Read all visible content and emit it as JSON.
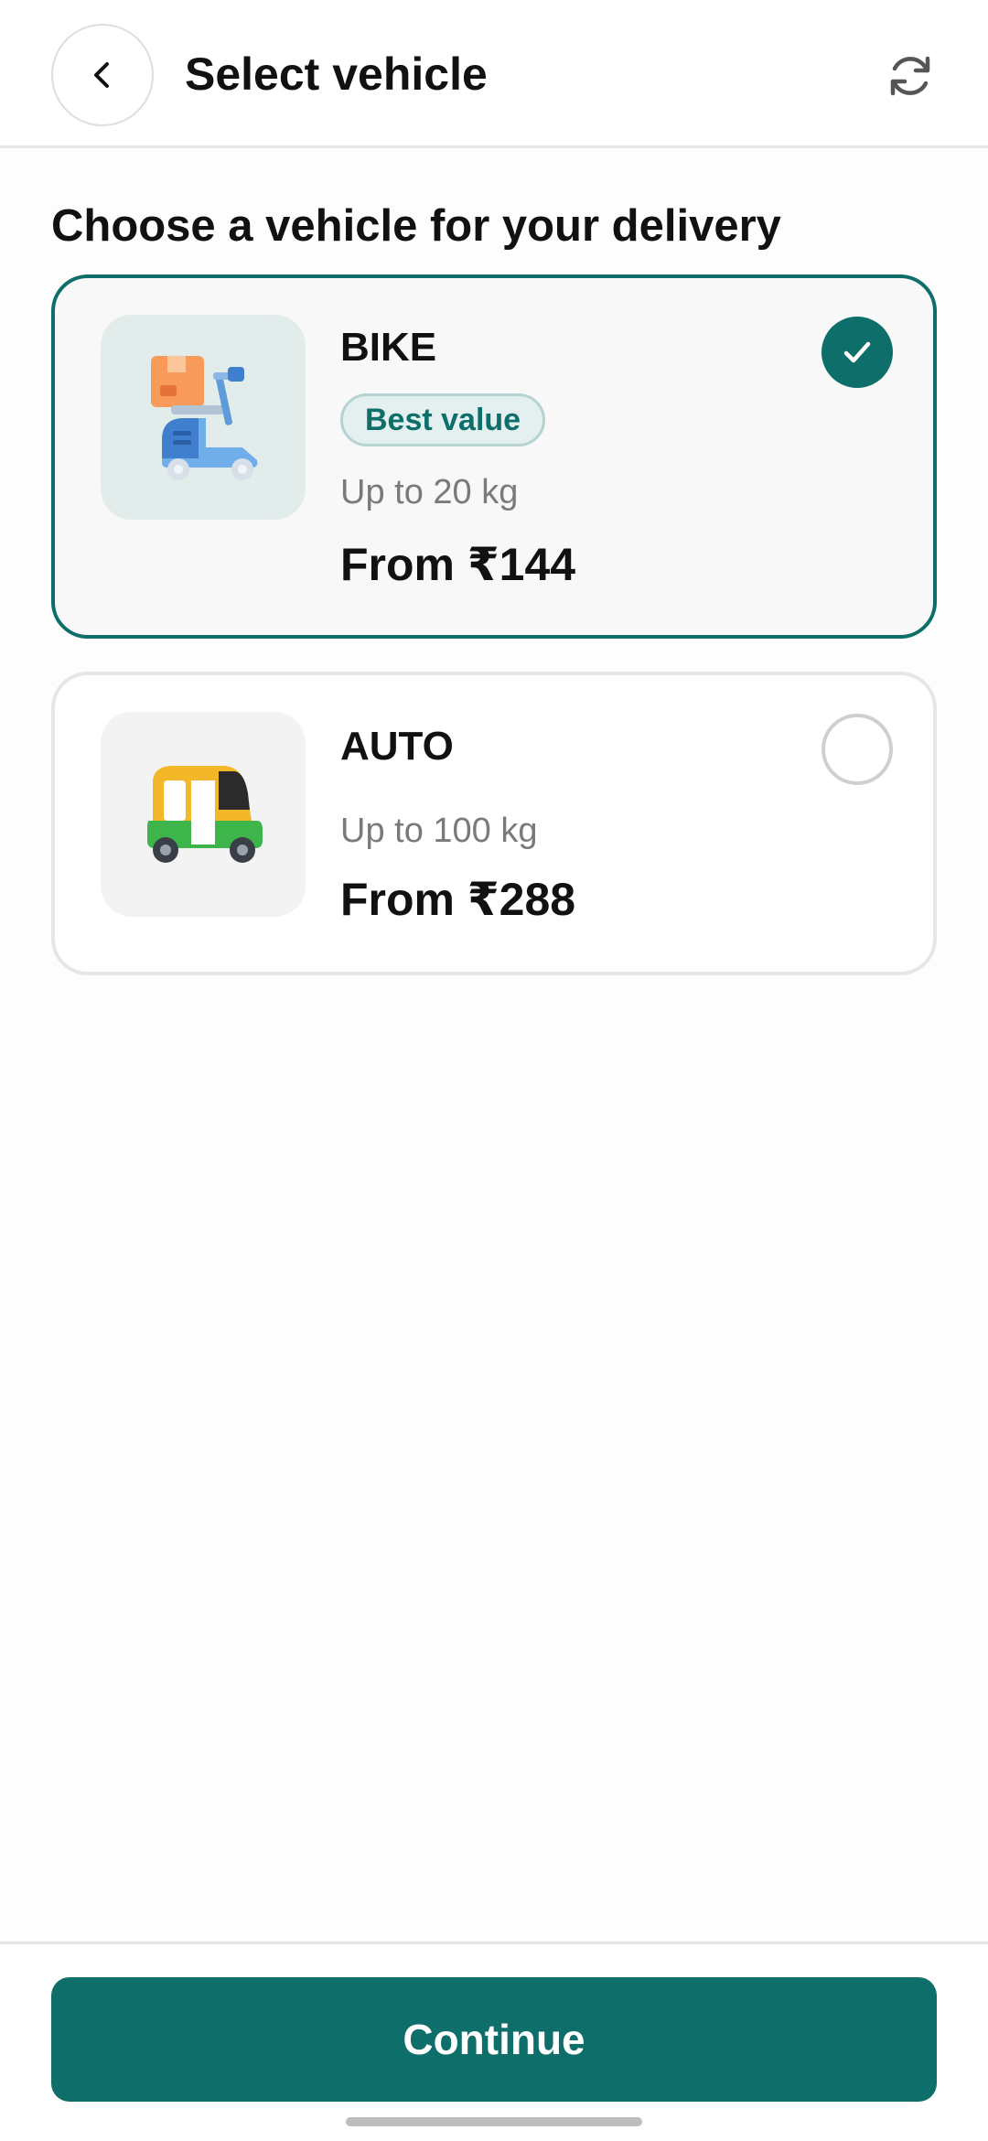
{
  "header": {
    "title": "Select vehicle",
    "back_icon": "chevron-left-icon",
    "refresh_icon": "refresh-icon"
  },
  "section_title": "Choose a vehicle for your delivery",
  "vehicles": [
    {
      "name": "BIKE",
      "badge": "Best value",
      "capacity": "Up to 20 kg",
      "price": "From ₹144",
      "selected": true,
      "icon": "scooter-delivery-icon"
    },
    {
      "name": "AUTO",
      "capacity": "Up to 100 kg",
      "price": "From ₹288",
      "selected": false,
      "icon": "auto-rickshaw-icon"
    }
  ],
  "footer": {
    "continue_label": "Continue"
  },
  "colors": {
    "accent": "#0d6e6a",
    "badge_bg": "#e3f0ef",
    "muted_text": "#7a7a7a",
    "border": "#e6e6e6"
  }
}
